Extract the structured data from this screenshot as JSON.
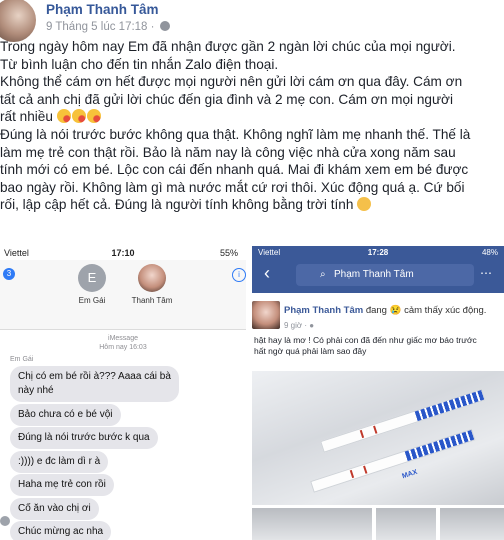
{
  "post": {
    "author": "Phạm Thanh Tâm",
    "date": "9 Tháng 5 lúc 17:18 ·",
    "lines": [
      "Trong ngày hôm nay Em đã nhận được gần 2 ngàn lời chúc của mọi người.",
      "Từ bình luận cho đến tin nhắn Zalo điện thoại.",
      "Không thể cám ơn hết được mọi người nên gửi lời cám ơn qua đây. Cám ơn",
      "tất cả anh chị đã gửi lời chúc đến gia đình và 2 mẹ con. Cám ơn mọi người",
      "rất nhiều",
      "Đúng là nói trước bước không qua thật. Không nghĩ làm mẹ nhanh thế. Thế là",
      "làm mẹ trẻ con thật rồi. Bảo là năm nay là công việc nhà cửa xong năm sau",
      "tính mới có em bé. Lộc con cái đến nhanh quá. Mai đi khám xem em bé được",
      "bao ngày rồi. Không làm gì mà nước mắt cứ rơi thôi. Xúc động quá ạ. Cứ bối",
      "rối, lập cập hết cả. Đúng là người tính không bằng trời tính"
    ]
  },
  "imessage": {
    "carrier": "Viettel",
    "time": "17:10",
    "battery": "55%",
    "back_count": "3",
    "contact_1_initial": "E",
    "contact_1_name": "Em Gái",
    "contact_2_name": "Thanh Tâm",
    "meta_line_1": "iMessage",
    "meta_line_2": "Hôm nay 16:03",
    "sender": "Em Gái",
    "messages": [
      "Chị có em bé rồi à??? Aaaa cái bà",
      "này nhé",
      "Bảo chưa có e bé vội",
      "Đúng là nói trước bước k qua",
      ":)))) e đc làm dì r à",
      "Haha mẹ trẻ con rồi",
      "Cố ăn vào chị ơi",
      "Chúc mừng ac nha"
    ]
  },
  "facebook": {
    "carrier": "Viettel",
    "time": "17:28",
    "battery": "48%",
    "search_text": "Phạm Thanh Tâm",
    "author": "Phạm Thanh Tâm",
    "feeling": " đang 😢 cảm thấy xúc động.",
    "time_ago": "9 giờ · ",
    "caption_1": "hật hay là mơ ! Có phải con đã đến như giấc mơ báo trước",
    "caption_2": "hất ngờ quá phải làm sao đây",
    "strip_label": "MAX"
  }
}
